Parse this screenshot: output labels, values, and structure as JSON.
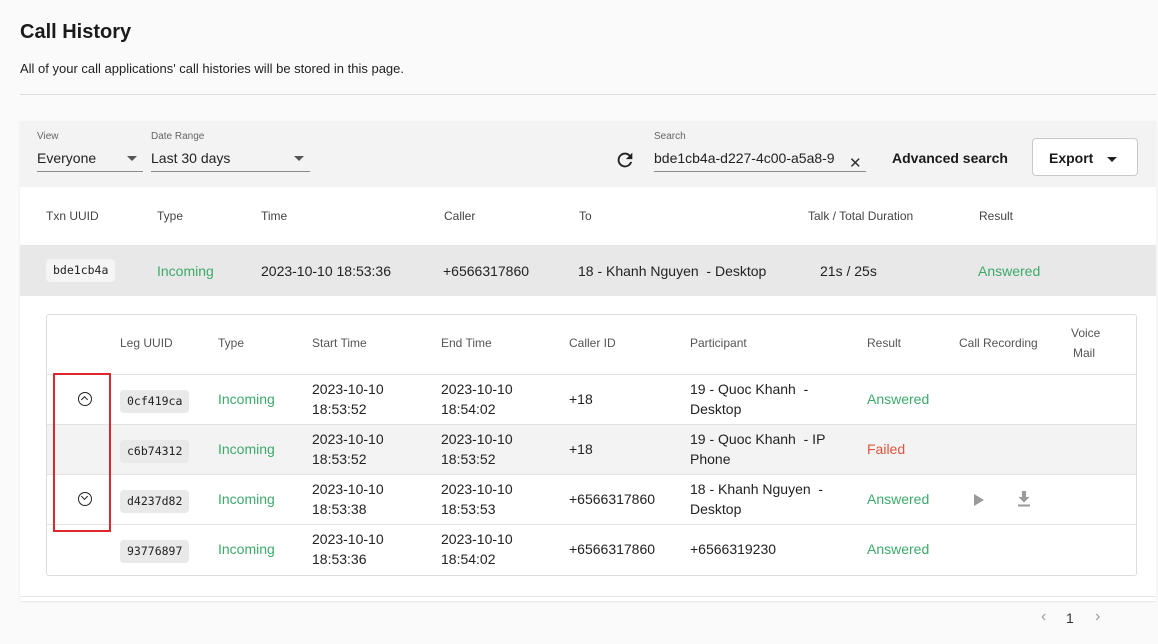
{
  "page": {
    "title": "Call History",
    "subtitle": "All of your call applications' call histories will be stored in this page."
  },
  "filters": {
    "view_label": "View",
    "view_value": "Everyone",
    "date_label": "Date Range",
    "date_value": "Last 30 days",
    "search_label": "Search",
    "search_value": "bde1cb4a-d227-4c00-a5a8-9",
    "advanced_search": "Advanced search",
    "export_label": "Export"
  },
  "main_table": {
    "headers": [
      "Txn UUID",
      "Type",
      "Time",
      "Caller",
      "To",
      "Talk / Total Duration",
      "Result"
    ],
    "row": {
      "txn": "bde1cb4a",
      "type": "Incoming",
      "time": "2023-10-10 18:53:36",
      "caller": "+6566317860",
      "to": "18 - Khanh Nguyen  - Desktop",
      "duration": "21s / 25s",
      "result": "Answered"
    }
  },
  "legs_table": {
    "headers": [
      "Leg UUID",
      "Type",
      "Start Time",
      "End Time",
      "Caller ID",
      "Participant",
      "Result",
      "Call Recording",
      "Voice",
      "Mail"
    ],
    "rows": [
      {
        "leg": "0cf419ca",
        "type": "Incoming",
        "start_date": "2023-10-10",
        "start_time": "18:53:52",
        "end_date": "2023-10-10",
        "end_time": "18:54:02",
        "caller": "+18",
        "p1": "19 - Quoc Khanh  -",
        "p2": "Desktop",
        "result": "Answered",
        "expand": "up"
      },
      {
        "leg": "c6b74312",
        "type": "Incoming",
        "start_date": "2023-10-10",
        "start_time": "18:53:52",
        "end_date": "2023-10-10",
        "end_time": "18:53:52",
        "caller": "+18",
        "p1": "19 - Quoc Khanh  - IP",
        "p2": "Phone",
        "result": "Failed",
        "expand": ""
      },
      {
        "leg": "d4237d82",
        "type": "Incoming",
        "start_date": "2023-10-10",
        "start_time": "18:53:38",
        "end_date": "2023-10-10",
        "end_time": "18:53:53",
        "caller": "+6566317860",
        "p1": "18 - Khanh Nguyen  -",
        "p2": "Desktop",
        "result": "Answered",
        "expand": "down"
      },
      {
        "leg": "93776897",
        "type": "Incoming",
        "start_date": "2023-10-10",
        "start_time": "18:53:36",
        "end_date": "2023-10-10",
        "end_time": "18:54:02",
        "caller": "+6566317860",
        "p1": "+6566319230",
        "p2": "",
        "result": "Answered",
        "expand": ""
      }
    ]
  },
  "pager": {
    "prev": "‹",
    "current": "1",
    "next": "›"
  },
  "colors": {
    "answered": "#3daa6b",
    "failed": "#e0533d",
    "highlight": "#e0262b"
  }
}
